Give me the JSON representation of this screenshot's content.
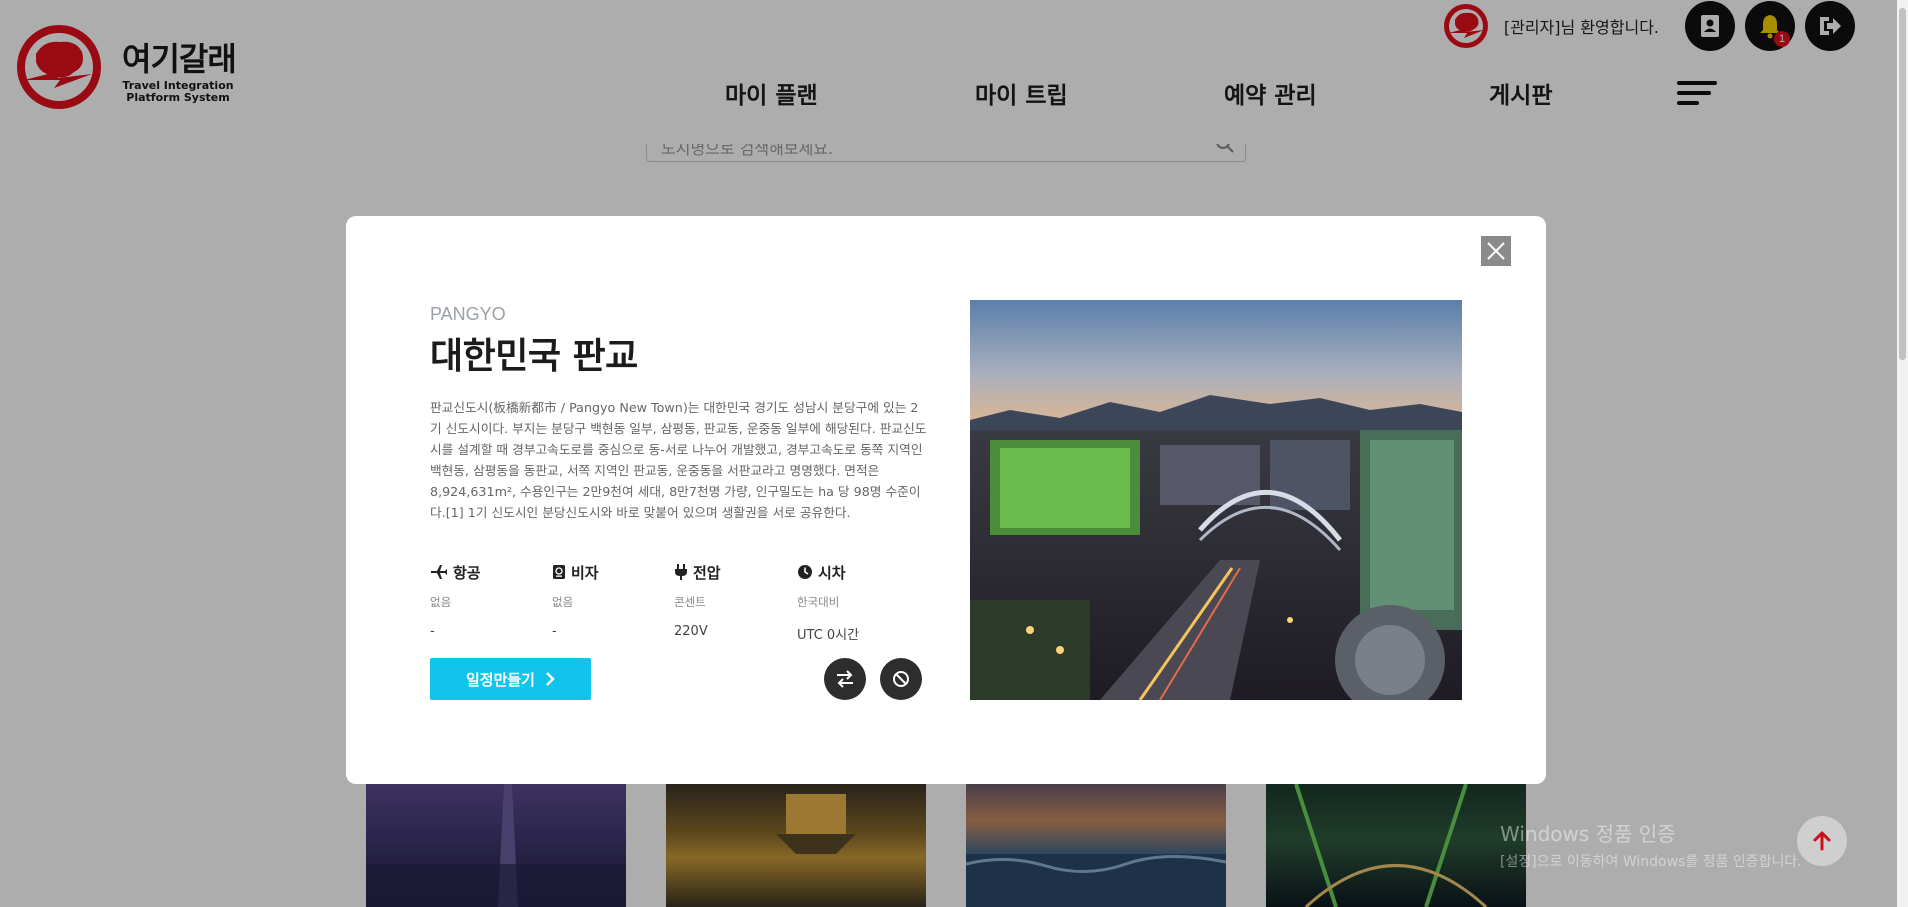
{
  "header": {
    "logo_ko": "여기갈래",
    "logo_en_line1": "Travel Integration",
    "logo_en_line2": "Platform System",
    "welcome": "[관리자]님 환영합니다.",
    "notification_count": "1",
    "nav": [
      "마이 플랜",
      "마이 트립",
      "예약 관리",
      "게시판"
    ],
    "brand_color": "#e3101b"
  },
  "search": {
    "placeholder": "도시명으로 검색해보세요."
  },
  "modal": {
    "subtitle": "PANGYO",
    "title": "대한민국 판교",
    "description": "판교신도시(板橋新都市 / Pangyo New Town)는 대한민국 경기도 성남시 분당구에 있는 2기 신도시이다. 부지는 분당구 백현동 일부, 삼평동, 판교동, 운중동 일부에 해당된다. 판교신도시를 설계할 때 경부고속도로를 중심으로 동-서로 나누어 개발했고, 경부고속도로 동쪽 지역인 백현동, 삼평동을 동판교, 서쪽 지역인 판교동, 운중동을 서판교라고 명명했다. 면적은 8,924,631m², 수용인구는 2만9천여 세대, 8만7천명 가량, 인구밀도는 ha 당 98명 수준이다.[1] 1기 신도시인 분당신도시와 바로 맞붙어 있으며 생활권을 서로 공유한다.",
    "info": [
      {
        "icon": "plane-icon",
        "label": "항공",
        "caption": "없음",
        "value": "-"
      },
      {
        "icon": "passport-icon",
        "label": "비자",
        "caption": "없음",
        "value": "-"
      },
      {
        "icon": "plug-icon",
        "label": "전압",
        "caption": "콘센트",
        "value": "220V"
      },
      {
        "icon": "clock-icon",
        "label": "시차",
        "caption": "한국대비",
        "value": "UTC 0시간"
      }
    ],
    "plan_button": "일정만들기",
    "accent_color": "#12c4ec"
  },
  "watermark": {
    "line1": "Windows 정품 인증",
    "line2": "[설정]으로 이동하여 Windows를 정품 인증합니다."
  }
}
